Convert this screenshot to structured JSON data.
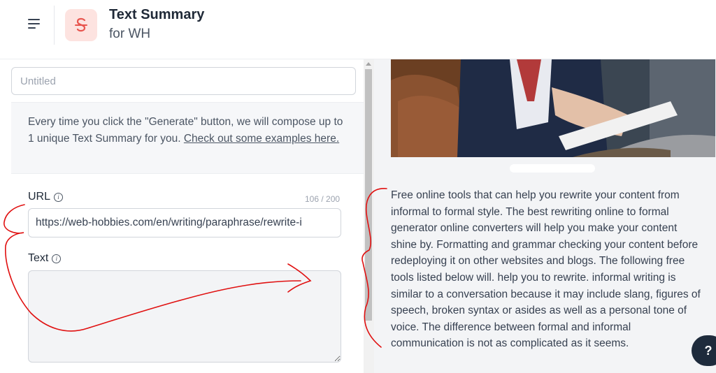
{
  "header": {
    "title": "Text Summary",
    "subtitle": "for WH",
    "menu_icon": "hamburger-menu-icon",
    "logo_icon": "text-summary-logo-icon"
  },
  "form": {
    "title_placeholder": "Untitled",
    "info_text": "Every time you click the \"Generate\" button, we will compose up to 1 unique Text Summary for you. ",
    "info_link": "Check out some examples here.",
    "url_label": "URL",
    "url_counter": "106 / 200",
    "url_value": "https://web-hobbies.com/en/writing/paraphrase/rewrite-i",
    "text_label": "Text",
    "text_value": ""
  },
  "result": {
    "text": "Free online tools that can help you rewrite your content from informal to formal style. The best rewriting online to formal generator online converters will help you make your content shine by. Formatting and grammar checking your content before redeploying it on other websites and blogs. The following free tools listed below will. help you to rewrite. informal writing is similar to a conversation because it may include slang, figures of speech, broken syntax or asides as well as a personal tone of voice. The difference between formal and informal communication is not as complicated as it seems."
  },
  "help": {
    "label": "?"
  },
  "colors": {
    "accent": "#e8554e",
    "logo_bg": "#fde3e0",
    "annotation": "#e01010",
    "help_bg": "#1e2b3c"
  }
}
